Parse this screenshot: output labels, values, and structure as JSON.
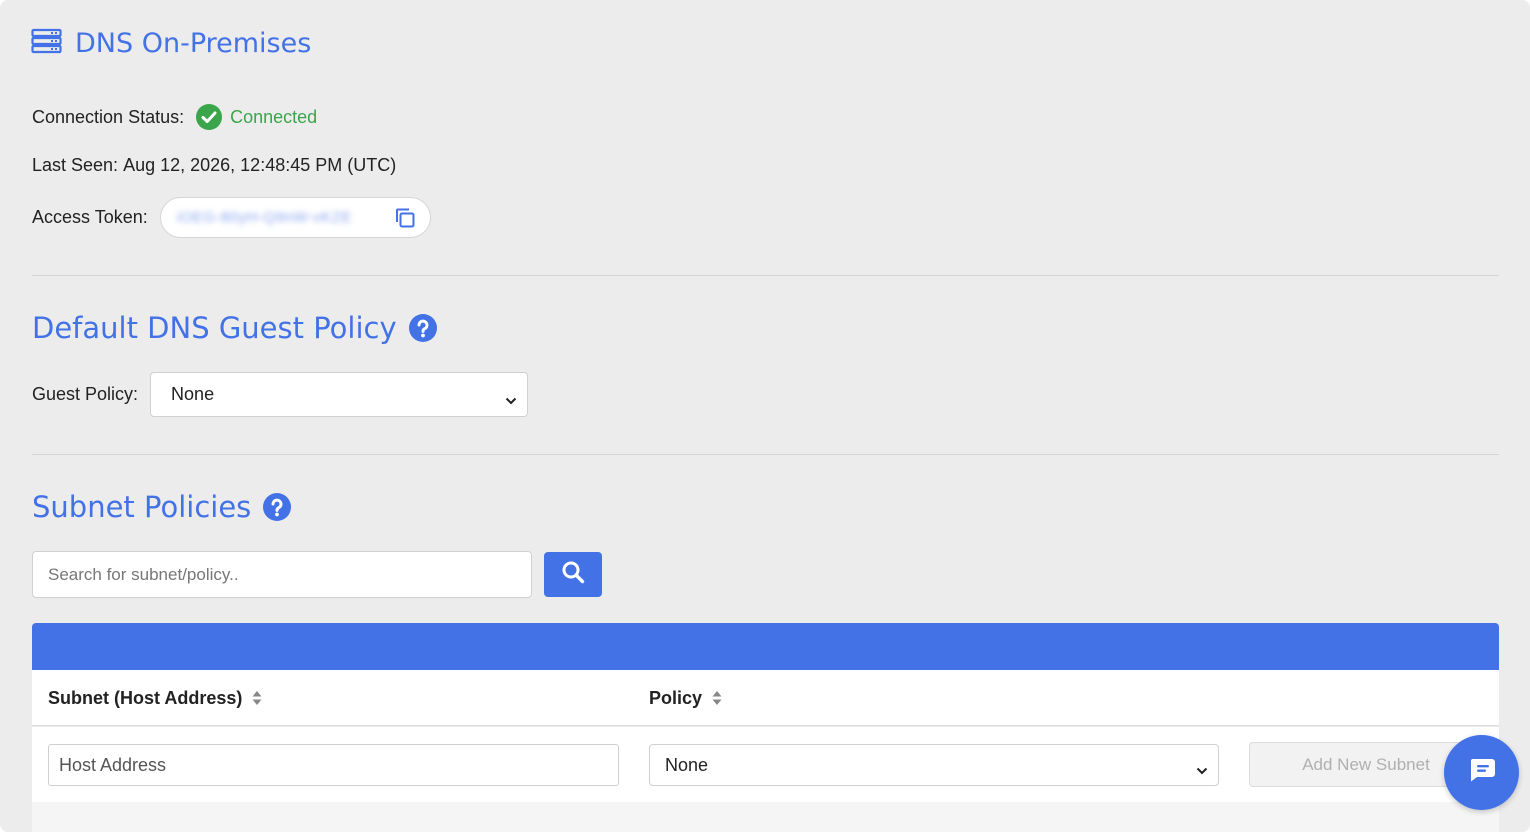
{
  "header": {
    "title": "DNS On-Premises",
    "icon": "server-icon"
  },
  "connection": {
    "status_label": "Connection Status:",
    "status_value": "Connected",
    "last_seen_label": "Last Seen:",
    "last_seen_value": "Aug 12, 2026, 12:48:45 PM (UTC)",
    "token_label": "Access Token:",
    "token_value": "iOEG-80yH-Q9nW-vKZE"
  },
  "guest_policy": {
    "section_title": "Default DNS Guest Policy",
    "label": "Guest Policy:",
    "selected": "None"
  },
  "subnet_policies": {
    "section_title": "Subnet Policies",
    "search_placeholder": "Search for subnet/policy..",
    "columns": [
      "Subnet (Host Address)",
      "Policy"
    ],
    "new_row": {
      "host_placeholder": "Host Address",
      "policy_selected": "None",
      "add_button": "Add New Subnet"
    }
  },
  "colors": {
    "accent": "#4272e6",
    "success": "#3aa54a",
    "background": "#ececec"
  }
}
